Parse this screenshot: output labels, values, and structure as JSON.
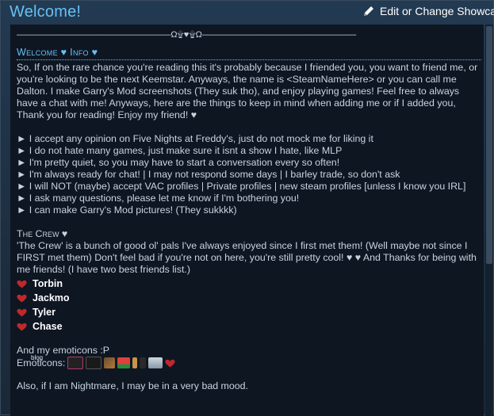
{
  "header": {
    "title": "Welcome!",
    "edit_label": "Edit or Change Showcase"
  },
  "divider": {
    "text": "——————————————————Ω۩♥۩Ω——————————————————"
  },
  "welcome": {
    "title": "Welcome ♥ Info ♥",
    "intro": "So, If on the rare chance you're reading this it's probably because I friended you, you want to friend me, or you're looking to be the next Keemstar. Anyways, the name is <SteamNameHere> or you can call me Dalton. I make Garry's Mod screenshots (They suk tho), and enjoy playing games! Feel free to always have a chat with me! Anyways, here are the things to keep in mind when adding me or if I added you, Thank you for reading! Enjoy my friend! ♥",
    "rules": [
      "► I accept any opinion on Five Nights at Freddy's, just do not mock me for liking it",
      "► I do not hate many games, just make sure it isnt a show I hate, like MLP",
      "► I'm pretty quiet, so you may have to start a conversation every so often!",
      "► I'm always ready for chat! | I may not respond some days | I barley trade, so don't ask",
      "► I will NOT (maybe) accept VAC profiles | Private profiles | new steam profiles [unless I know you IRL]",
      "► I ask many questions, please let me know if I'm bothering you!",
      "► I can make Garry's Mod pictures! (They sukkkk)"
    ]
  },
  "crew": {
    "title": "The Crew ♥",
    "text": "'The Crew' is a bunch of good ol' pals I've always enjoyed since I first met them! (Well maybe not since I FIRST met them) Don't feel bad if you're not on here, you're still pretty cool! ♥ ♥ And Thanks for being with me friends! (I have two best friends list.)",
    "members": [
      "Torbin",
      "Jackmo",
      "Tyler",
      "Chase"
    ]
  },
  "emoticons": {
    "intro": "And my emoticons :P",
    "label": "Emoticons:",
    "overlay": "blog"
  },
  "footer": {
    "text": "Also, if I am Nightmare, I may be in a very bad mood."
  },
  "colors": {
    "accent": "#66c0f4",
    "background": "#1b2838",
    "panel": "#0e1622",
    "text": "#c6d4df",
    "heart": "#c0282b"
  }
}
